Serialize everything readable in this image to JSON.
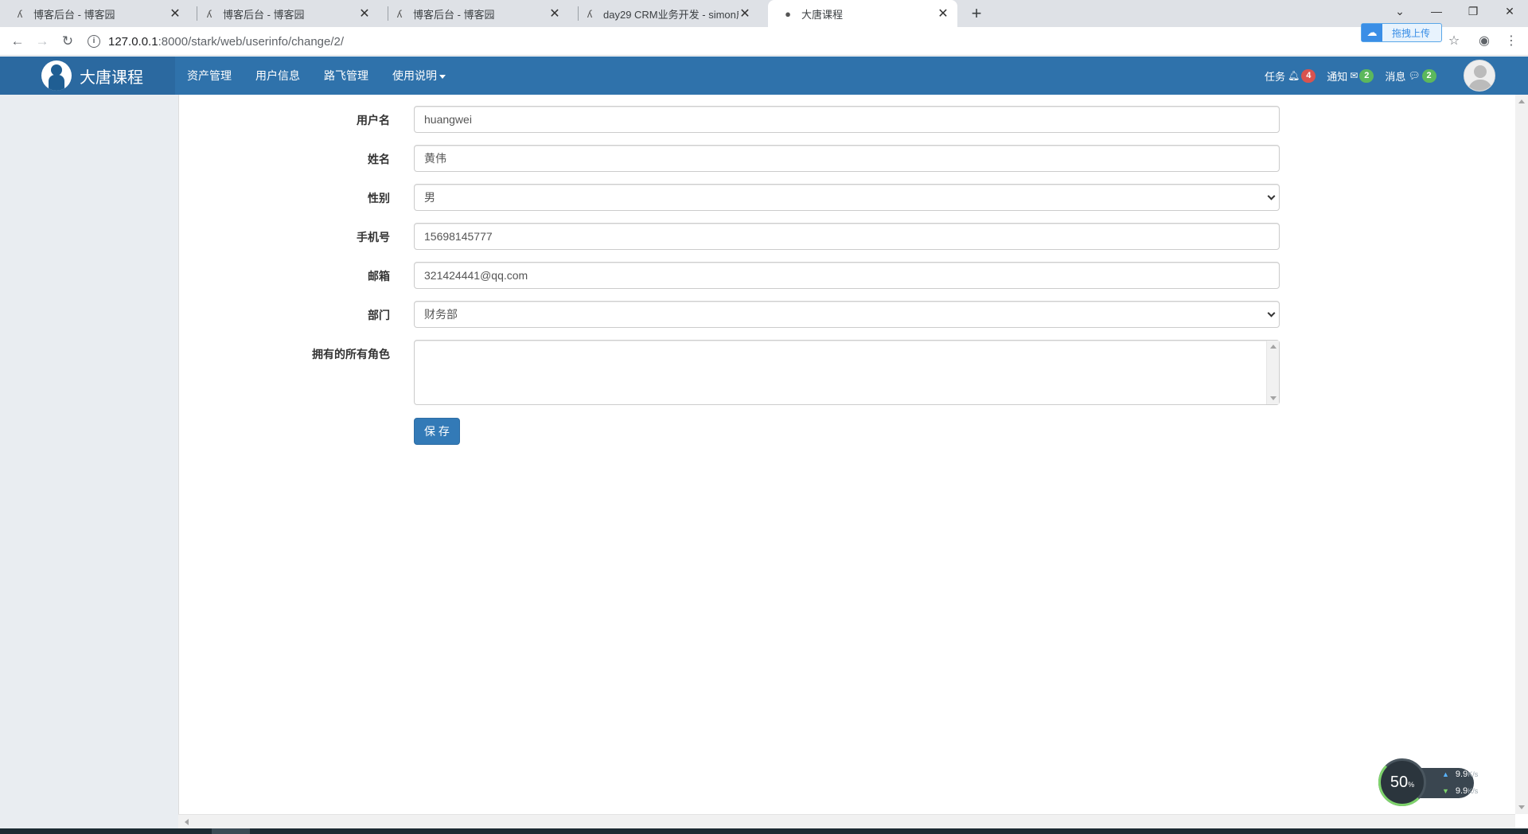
{
  "browser": {
    "tabs": [
      {
        "title": "博客后台 - 博客园",
        "icon": "cnblogs-icon"
      },
      {
        "title": "博客后台 - 博客园",
        "icon": "cnblogs-icon"
      },
      {
        "title": "博客后台 - 博客园",
        "icon": "cnblogs-icon"
      },
      {
        "title": "day29 CRM业务开发 - simon成",
        "icon": "cnblogs-icon"
      },
      {
        "title": "大唐课程",
        "icon": "site-logo-icon"
      }
    ],
    "url_host": "127.0.0.1",
    "url_path": ":8000/stark/web/userinfo/change/2/",
    "upload_button": "拖拽上传"
  },
  "navbar": {
    "brand": "大唐课程",
    "menu": [
      {
        "label": "资产管理"
      },
      {
        "label": "用户信息"
      },
      {
        "label": "路飞管理"
      },
      {
        "label": "使用说明"
      }
    ],
    "right": [
      {
        "label": "任务",
        "icon": "bell-icon",
        "count": "4",
        "color": "#d9534f"
      },
      {
        "label": "通知",
        "icon": "envelope-icon",
        "count": "2",
        "color": "#5cb85c"
      },
      {
        "label": "消息",
        "icon": "comment-icon",
        "count": "2",
        "color": "#5cb85c"
      }
    ]
  },
  "form": {
    "username": {
      "label": "用户名",
      "value": "huangwei"
    },
    "name": {
      "label": "姓名",
      "value": "黄伟"
    },
    "gender": {
      "label": "性别",
      "value": "男"
    },
    "phone": {
      "label": "手机号",
      "value": "15698145777"
    },
    "email": {
      "label": "邮箱",
      "value": "321424441@qq.com"
    },
    "department": {
      "label": "部门",
      "value": "财务部"
    },
    "roles": {
      "label": "拥有的所有角色"
    },
    "save_label": "保 存"
  },
  "netspeed": {
    "percent": "50",
    "percent_unit": "%",
    "up": "9.9",
    "down": "9.9",
    "unit": "K/s"
  },
  "colors": {
    "navbar": "#2f72ab",
    "primary_button": "#337ab7",
    "sidebar": "#e9edf1"
  }
}
